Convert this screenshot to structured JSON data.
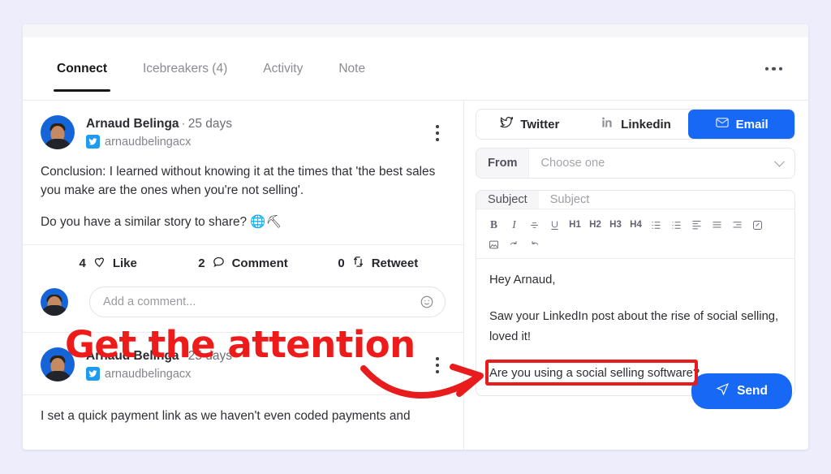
{
  "theme": {
    "page_bg": "#eeedfb",
    "accent_blue": "#1668f5",
    "annotation_red": "#ee1b1b",
    "twitter_blue": "#1d9bf0"
  },
  "tabs": [
    {
      "label": "Connect",
      "active": true
    },
    {
      "label": "Icebreakers (4)",
      "active": false
    },
    {
      "label": "Activity",
      "active": false
    },
    {
      "label": "Note",
      "active": false
    }
  ],
  "posts": [
    {
      "author": "Arnaud Belinga",
      "separator": "·",
      "age": "25 days",
      "handle": "arnaudbelingacx",
      "paragraphs": [
        "Conclusion: I learned without knowing it at the times that 'the best sales you make are the ones when you're not selling'.",
        "Do you have a similar story to share? 🌐⛏"
      ],
      "engagement": [
        {
          "count": "4",
          "label": "Like",
          "icon": "heart-icon"
        },
        {
          "count": "2",
          "label": "Comment",
          "icon": "comment-icon"
        },
        {
          "count": "0",
          "label": "Retweet",
          "icon": "retweet-icon"
        }
      ],
      "comment_placeholder": "Add a comment..."
    },
    {
      "author": "Arnaud Belinga",
      "separator": "·",
      "age": "25 days",
      "handle": "arnaudbelingacx",
      "paragraphs": [
        "I set a quick payment link as we haven't even coded payments and"
      ]
    }
  ],
  "composer": {
    "channels": [
      {
        "label": "Twitter",
        "icon": "twitter-icon",
        "active": false
      },
      {
        "label": "Linkedin",
        "icon": "linkedin-icon",
        "active": false
      },
      {
        "label": "Email",
        "icon": "email-icon",
        "active": true
      }
    ],
    "from": {
      "label": "From",
      "value": "Choose one"
    },
    "subject": {
      "label": "Subject",
      "placeholder": "Subject"
    },
    "toolbar": [
      {
        "name": "bold-icon",
        "glyph": "B",
        "style": "serif-bold"
      },
      {
        "name": "italic-icon",
        "glyph": "I",
        "style": "serif-italic"
      },
      {
        "name": "strikethrough-icon",
        "glyph": "",
        "style": "svg"
      },
      {
        "name": "underline-icon",
        "glyph": "",
        "style": "svg"
      },
      {
        "name": "heading-1-icon",
        "glyph": "H1",
        "style": "sans"
      },
      {
        "name": "heading-2-icon",
        "glyph": "H2",
        "style": "sans"
      },
      {
        "name": "heading-3-icon",
        "glyph": "H3",
        "style": "sans"
      },
      {
        "name": "heading-4-icon",
        "glyph": "H4",
        "style": "sans"
      },
      {
        "name": "bullet-list-icon",
        "glyph": "",
        "style": "svg"
      },
      {
        "name": "numbered-list-icon",
        "glyph": "",
        "style": "svg"
      },
      {
        "name": "align-left-icon",
        "glyph": "",
        "style": "svg"
      },
      {
        "name": "align-center-icon",
        "glyph": "",
        "style": "svg"
      },
      {
        "name": "align-right-icon",
        "glyph": "",
        "style": "svg"
      },
      {
        "name": "link-icon",
        "glyph": "",
        "style": "svg"
      },
      {
        "name": "image-icon",
        "glyph": "",
        "style": "svg"
      },
      {
        "name": "redo-icon",
        "glyph": "",
        "style": "svg"
      },
      {
        "name": "undo-icon",
        "glyph": "",
        "style": "svg"
      }
    ],
    "body": {
      "greeting": "Hey Arnaud,",
      "paragraph": "Saw your LinkedIn post about the rise of social selling, loved it!",
      "question": "Are you using a social selling software?"
    },
    "send_label": "Send"
  },
  "annotations": {
    "headline": "Get the attention",
    "arrow": "curved-arrow-right",
    "highlight_target": "Are you using a social selling software?"
  },
  "overflow_menu": "more-options"
}
